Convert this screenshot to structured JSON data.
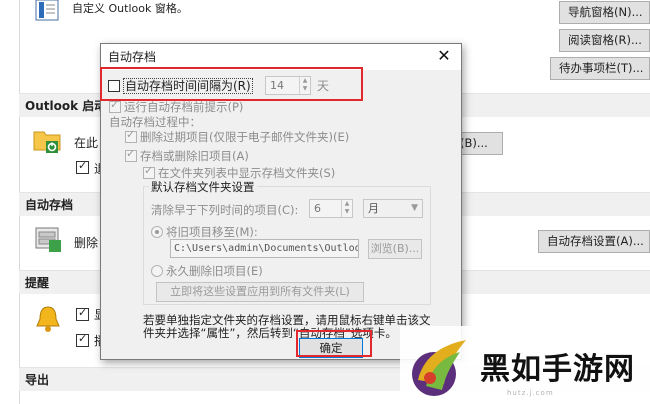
{
  "background": {
    "header_text": "自定义 Outlook 窗格。",
    "buttons": {
      "nav_pane": "导航窗格(N)...",
      "reading_pane": "阅读窗格(R)...",
      "todo_bar": "待办事项栏(T)...",
      "partial_b": "(B)...",
      "autoarchive_settings": "自动存档设置(A)..."
    },
    "sections": {
      "outlook_start": "Outlook 启动",
      "autoarchive": "自动存档",
      "reminders": "提醒",
      "export": "导出"
    },
    "partial_texts": {
      "start_row": "在此",
      "start_sub": "退",
      "autoarchive_row": "删除",
      "reminder_row1": "显",
      "reminder_row2": "播"
    }
  },
  "dialog": {
    "title": "自动存档",
    "close_glyph": "✕",
    "autoarchive_every_label": "自动存档时间间隔为(R)",
    "interval_value": "14",
    "interval_unit": "天",
    "prompt_before": "运行自动存档前提示(P)",
    "during_label": "自动存档过程中：",
    "delete_expired": "删除过期项目(仅限于电子邮件文件夹)(E)",
    "archive_or_delete": "存档或删除旧项目(A)",
    "show_in_folder_list": "在文件夹列表中显示存档文件夹(S)",
    "default_group_label": "默认存档文件夹设置",
    "clean_older_label": "清除早于下列时间的项目(C):",
    "clean_value": "6",
    "clean_unit": "月",
    "move_to_label": "将旧项目移至(M):",
    "archive_path": "C:\\Users\\admin\\Documents\\Outlook",
    "browse_button": "浏览(B)...",
    "permanently_delete": "永久删除旧项目(E)",
    "apply_all_button": "立即将这些设置应用到所有文件夹(L)",
    "footer_text_line1": "若要单独指定文件夹的存档设置，请用鼠标右键单击该文",
    "footer_text_line2": "件夹并选择“属性”，然后转到“自动存档”选项卡。",
    "ok_button": "确定"
  },
  "watermark": {
    "text": "黑如手游网",
    "url": "hutz.j.com"
  },
  "colors": {
    "highlight": "#e0282e",
    "dialog_bg": "#f0f0f0",
    "ok_border": "#0078d7"
  }
}
